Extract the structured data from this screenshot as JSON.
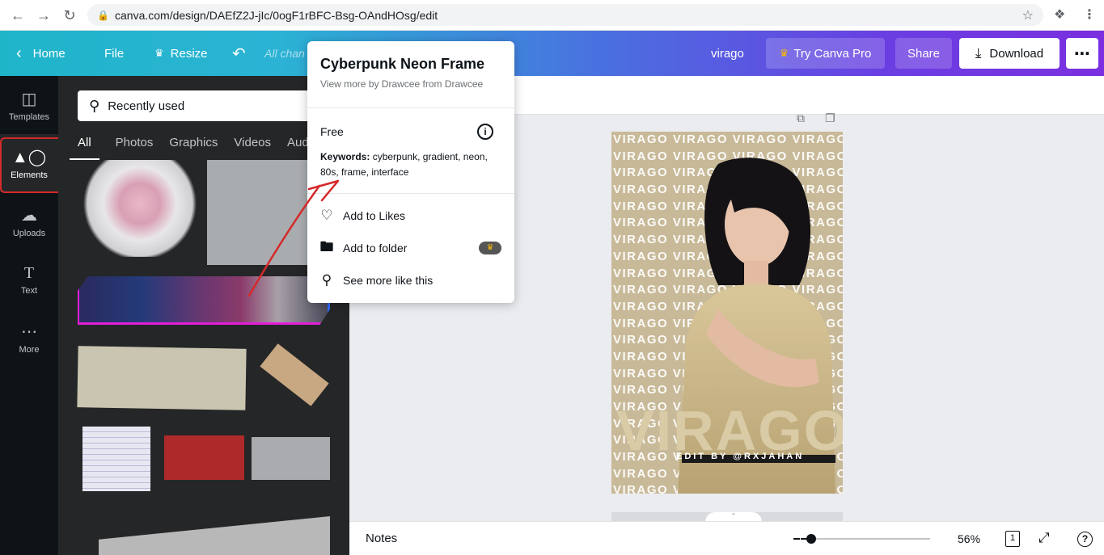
{
  "browser": {
    "url": "canva.com/design/DAEfZ2J-jIc/0ogF1rBFC-Bsg-OAndHOsg/edit"
  },
  "header": {
    "home": "Home",
    "file": "File",
    "resize": "Resize",
    "autosave": "All chan",
    "design_title": "virago",
    "try_pro": "Try Canva Pro",
    "share": "Share",
    "download": "Download"
  },
  "rail": {
    "items": [
      {
        "label": "Templates",
        "icon": "templates-icon"
      },
      {
        "label": "Elements",
        "icon": "elements-icon"
      },
      {
        "label": "Uploads",
        "icon": "uploads-icon"
      },
      {
        "label": "Text",
        "icon": "text-icon"
      },
      {
        "label": "More",
        "icon": "more-icon"
      }
    ],
    "active_index": 1
  },
  "panel": {
    "search_value": "Recently used",
    "tabs": [
      "All",
      "Photos",
      "Graphics",
      "Videos",
      "Aud"
    ],
    "active_tab": 0
  },
  "popup": {
    "title": "Cyberpunk Neon Frame",
    "subtitle": "View more by Drawcee from Drawcee",
    "license": "Free",
    "keywords_label": "Keywords:",
    "keywords": "cyberpunk, gradient, neon, 80s, frame, interface",
    "menu": [
      {
        "label": "Add to Likes",
        "icon": "heart-icon"
      },
      {
        "label": "Add to folder",
        "icon": "folder-icon"
      },
      {
        "label": "See more like this",
        "icon": "search-icon"
      }
    ]
  },
  "poster": {
    "repeat_word": "VIRAGO VIRAGO VIRAGO VIRAGO",
    "big_title": "VIRAGO",
    "credit": "EDIT BY @RXJAHAN"
  },
  "footer": {
    "notes": "Notes",
    "zoom": "56%",
    "zoom_fraction": 0.08,
    "page_count": "1"
  },
  "colors": {
    "header_start": "#1fb5c9",
    "header_end": "#7b2fe0",
    "rail_bg": "#0e1318",
    "panel_bg": "#252627",
    "annotation_red": "#d42a2a"
  }
}
